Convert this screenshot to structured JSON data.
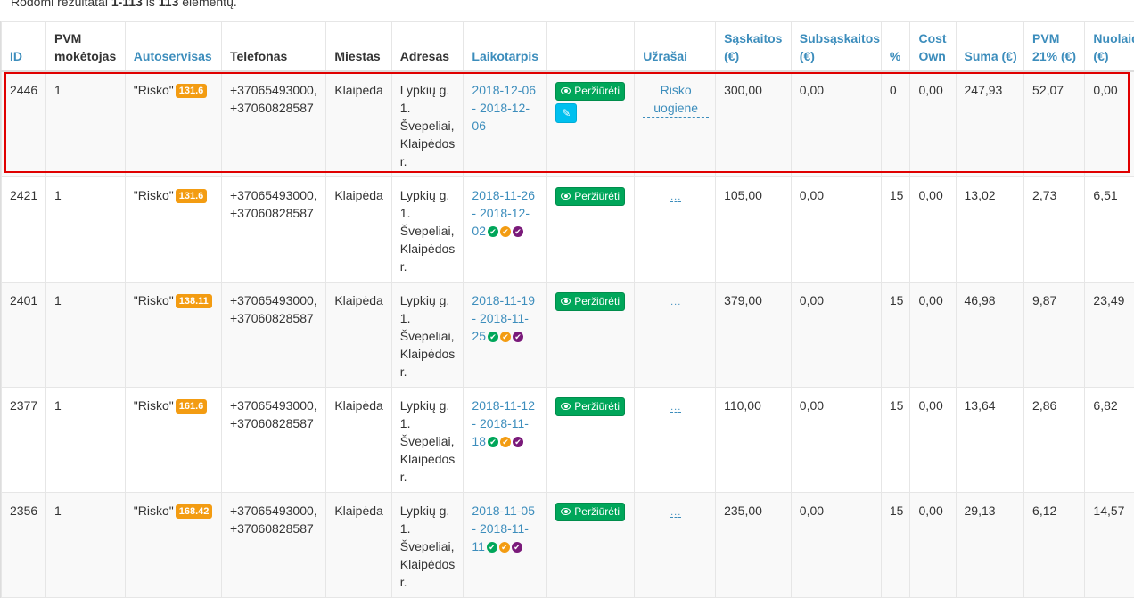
{
  "summary": {
    "prefix": "Rodomi rezultatai",
    "range": "1-113",
    "mid": "iš",
    "total": "113",
    "suffix": "elementų."
  },
  "headers": [
    {
      "label": "ID",
      "sortable": true
    },
    {
      "label": "PVM mokėtojas",
      "sortable": false
    },
    {
      "label": "Autoservisas",
      "sortable": true
    },
    {
      "label": "Telefonas",
      "sortable": false
    },
    {
      "label": "Miestas",
      "sortable": false
    },
    {
      "label": "Adresas",
      "sortable": false
    },
    {
      "label": "Laikotarpis",
      "sortable": true
    },
    {
      "label": "",
      "sortable": false
    },
    {
      "label": "Užrašai",
      "sortable": true
    },
    {
      "label": "Sąskaitos (€)",
      "sortable": true
    },
    {
      "label": "Subsąskaitos (€)",
      "sortable": true
    },
    {
      "label": "%",
      "sortable": true
    },
    {
      "label": "Cost Own",
      "sortable": true
    },
    {
      "label": "Suma (€)",
      "sortable": true
    },
    {
      "label": "PVM 21% (€)",
      "sortable": true
    },
    {
      "label": "Nuolaida (€)",
      "sortable": true
    }
  ],
  "view_label": "Peržiūrėti",
  "rows": [
    {
      "id": "2446",
      "pvm": "1",
      "service": "\"Risko\"",
      "badge": "131.6",
      "phone": "+37065493000, +37060828587",
      "city": "Klaipėda",
      "address": "Lypkių g. 1. Švepeliai, Klaipėdos r.",
      "period": "2018-12-06 - 2018-12-06",
      "status_dots": false,
      "edit": true,
      "note": "Risko uogiene",
      "invoices": "300,00",
      "subinvoices": "0,00",
      "percent": "0",
      "cost_own": "0,00",
      "sum": "247,93",
      "vat": "52,07",
      "discount": "0,00"
    },
    {
      "id": "2421",
      "pvm": "1",
      "service": "\"Risko\"",
      "badge": "131.6",
      "phone": "+37065493000, +37060828587",
      "city": "Klaipėda",
      "address": "Lypkių g. 1. Švepeliai, Klaipėdos r.",
      "period": "2018-11-26 - 2018-12-02",
      "status_dots": true,
      "edit": false,
      "note": "",
      "invoices": "105,00",
      "subinvoices": "0,00",
      "percent": "15",
      "cost_own": "0,00",
      "sum": "13,02",
      "vat": "2,73",
      "discount": "6,51"
    },
    {
      "id": "2401",
      "pvm": "1",
      "service": "\"Risko\"",
      "badge": "138.11",
      "phone": "+37065493000, +37060828587",
      "city": "Klaipėda",
      "address": "Lypkių g. 1. Švepeliai, Klaipėdos r.",
      "period": "2018-11-19 - 2018-11-25",
      "status_dots": true,
      "edit": false,
      "note": "",
      "invoices": "379,00",
      "subinvoices": "0,00",
      "percent": "15",
      "cost_own": "0,00",
      "sum": "46,98",
      "vat": "9,87",
      "discount": "23,49"
    },
    {
      "id": "2377",
      "pvm": "1",
      "service": "\"Risko\"",
      "badge": "161.6",
      "phone": "+37065493000, +37060828587",
      "city": "Klaipėda",
      "address": "Lypkių g. 1. Švepeliai, Klaipėdos r.",
      "period": "2018-11-12 - 2018-11-18",
      "status_dots": true,
      "edit": false,
      "note": "",
      "invoices": "110,00",
      "subinvoices": "0,00",
      "percent": "15",
      "cost_own": "0,00",
      "sum": "13,64",
      "vat": "2,86",
      "discount": "6,82"
    },
    {
      "id": "2356",
      "pvm": "1",
      "service": "\"Risko\"",
      "badge": "168.42",
      "phone": "+37065493000, +37060828587",
      "city": "Klaipėda",
      "address": "Lypkių g. 1. Švepeliai, Klaipėdos r.",
      "period": "2018-11-05 - 2018-11-11",
      "status_dots": true,
      "edit": false,
      "note": "",
      "invoices": "235,00",
      "subinvoices": "0,00",
      "percent": "15",
      "cost_own": "0,00",
      "sum": "29,13",
      "vat": "6,12",
      "discount": "14,57"
    }
  ],
  "empty_note": "...",
  "colors": {
    "link": "#3c8dbc",
    "badge": "#f39c12",
    "view_button": "#00a65a",
    "edit_button": "#00c0ef",
    "highlight": "#e00000"
  },
  "icons": {
    "view": "eye-icon",
    "edit": "pencil-icon",
    "dots": [
      "check-circle-icon",
      "check-circle-icon",
      "check-circle-icon"
    ]
  }
}
